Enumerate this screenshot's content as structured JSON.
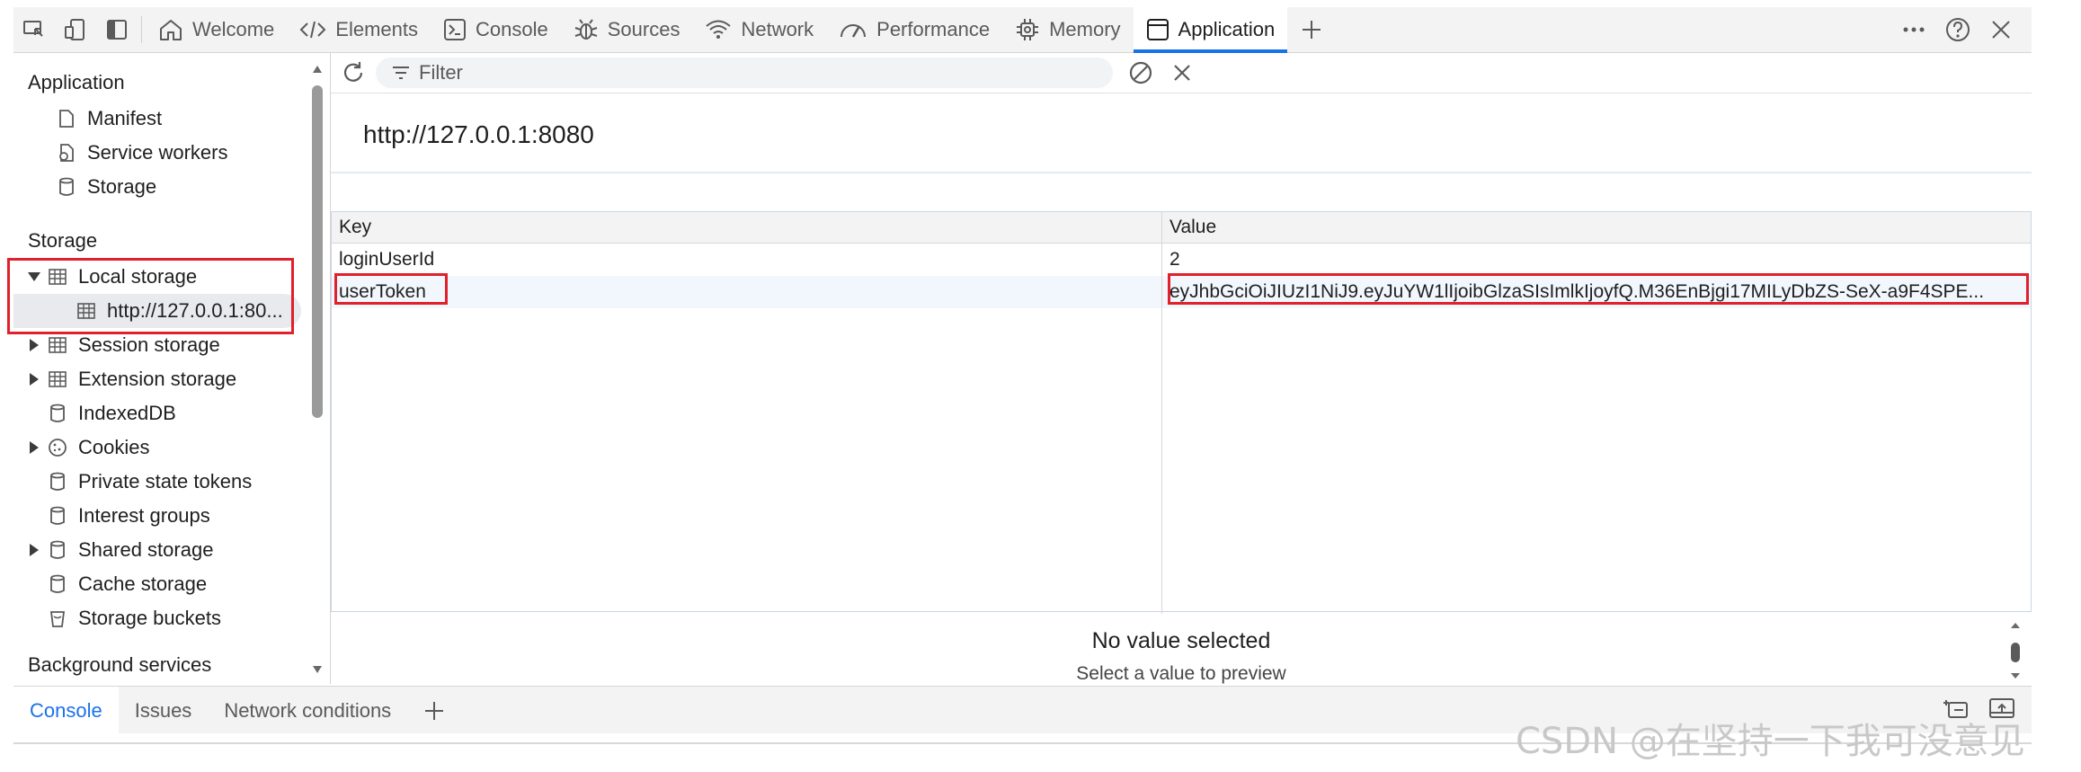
{
  "topbar": {
    "tabs": [
      {
        "label": "Welcome",
        "icon": "home-icon"
      },
      {
        "label": "Elements",
        "icon": "code-icon"
      },
      {
        "label": "Console",
        "icon": "terminal-icon"
      },
      {
        "label": "Sources",
        "icon": "bug-icon"
      },
      {
        "label": "Network",
        "icon": "wifi-icon"
      },
      {
        "label": "Performance",
        "icon": "gauge-icon"
      },
      {
        "label": "Memory",
        "icon": "chip-icon"
      },
      {
        "label": "Application",
        "icon": "window-icon",
        "active": true
      }
    ]
  },
  "sidebar": {
    "application_section": "Application",
    "application_items": [
      "Manifest",
      "Service workers",
      "Storage"
    ],
    "storage_section": "Storage",
    "storage_items": [
      {
        "label": "Local storage",
        "expanded": true
      },
      {
        "label": "http://127.0.0.1:80...",
        "selected": true
      },
      {
        "label": "Session storage"
      },
      {
        "label": "Extension storage"
      },
      {
        "label": "IndexedDB"
      },
      {
        "label": "Cookies"
      },
      {
        "label": "Private state tokens"
      },
      {
        "label": "Interest groups"
      },
      {
        "label": "Shared storage"
      },
      {
        "label": "Cache storage"
      },
      {
        "label": "Storage buckets"
      }
    ],
    "background_section": "Background services"
  },
  "toolbar": {
    "filter_placeholder": "Filter"
  },
  "origin": "http://127.0.0.1:8080",
  "table": {
    "headers": [
      "Key",
      "Value"
    ],
    "rows": [
      {
        "key": "loginUserId",
        "value": "2"
      },
      {
        "key": "userToken",
        "value": "eyJhbGciOiJIUzI1NiJ9.eyJuYW1lIjoibGlzaSIsImlkIjoyfQ.M36EnBjgi17MILyDbZS-SeX-a9F4SPE..."
      }
    ]
  },
  "preview": {
    "title": "No value selected",
    "subtitle": "Select a value to preview"
  },
  "drawer": {
    "tabs": [
      "Console",
      "Issues",
      "Network conditions"
    ]
  },
  "watermark": "CSDN @在坚持一下我可没意见",
  "colors": {
    "accent": "#1a73e8",
    "highlight": "#e0202a"
  }
}
